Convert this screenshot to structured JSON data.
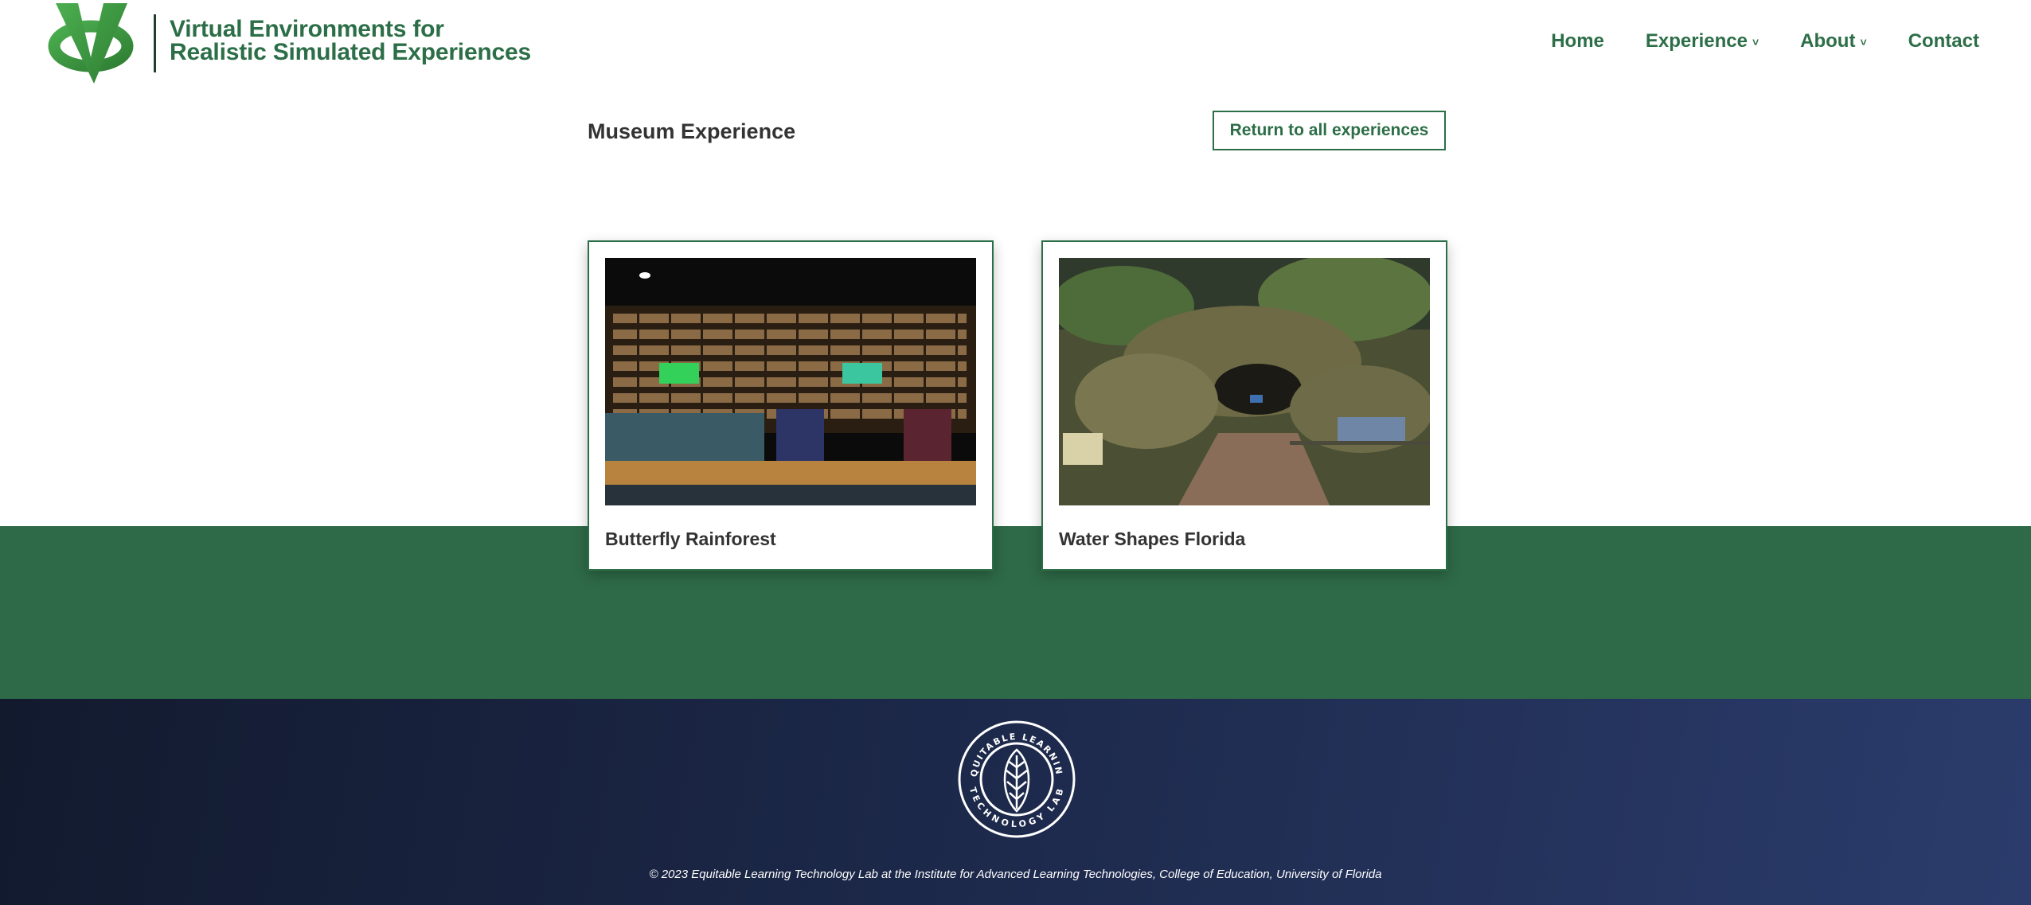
{
  "header": {
    "logo_line1": "Virtual Environments for",
    "logo_line2": "Realistic Simulated Experiences",
    "nav": [
      {
        "label": "Home"
      },
      {
        "label": "Experience"
      },
      {
        "label": "About"
      },
      {
        "label": "Contact"
      }
    ]
  },
  "page": {
    "title": "Museum Experience",
    "return_button": "Return to all experiences"
  },
  "cards": [
    {
      "title": "Butterfly Rainforest",
      "image": "museum-exhibit-wall-photo"
    },
    {
      "title": "Water Shapes Florida",
      "image": "florida-cave-diorama-photo"
    }
  ],
  "footer": {
    "logo_text_top": "EQUITABLE LEARNING",
    "logo_text_bottom": "TECHNOLOGY LAB",
    "copyright": "© 2023 Equitable Learning Technology Lab at the Institute for Advanced Learning Technologies, College of Education, University of Florida"
  },
  "colors": {
    "brand_green": "#2c6e47",
    "band_green": "#2e6a47",
    "footer_navy": "#1c2849",
    "text_dark": "#333333"
  }
}
